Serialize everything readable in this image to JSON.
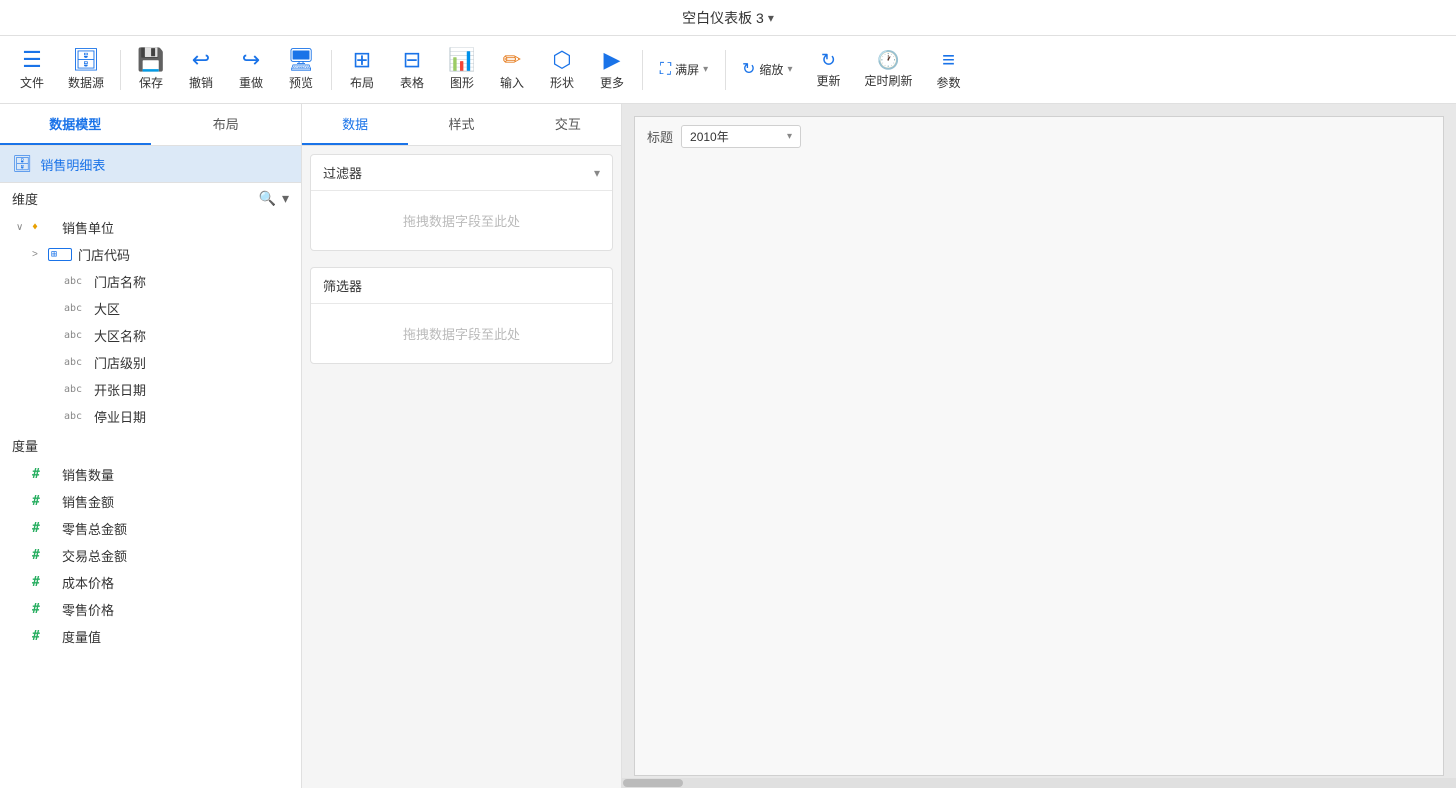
{
  "titleBar": {
    "title": "空白仪表板 3",
    "dropdownArrow": "▾"
  },
  "toolbar": {
    "items": [
      {
        "id": "file",
        "icon": "☰",
        "label": "文件",
        "iconColor": "default"
      },
      {
        "id": "datasource",
        "icon": "🗄",
        "label": "数据源",
        "iconColor": "blue"
      },
      {
        "id": "save",
        "icon": "💾",
        "label": "保存",
        "iconColor": "blue"
      },
      {
        "id": "undo",
        "icon": "↩",
        "label": "撤销",
        "iconColor": "blue"
      },
      {
        "id": "redo",
        "icon": "↪",
        "label": "重做",
        "iconColor": "blue"
      },
      {
        "id": "preview",
        "icon": "🖥",
        "label": "预览",
        "iconColor": "blue"
      },
      {
        "id": "layout",
        "icon": "⊞",
        "label": "布局",
        "iconColor": "blue"
      },
      {
        "id": "table",
        "icon": "⊟",
        "label": "表格",
        "iconColor": "blue"
      },
      {
        "id": "chart",
        "icon": "📊",
        "label": "图形",
        "iconColor": "blue"
      },
      {
        "id": "input",
        "icon": "✏",
        "label": "输入",
        "iconColor": "orange"
      },
      {
        "id": "shape",
        "icon": "⬡",
        "label": "形状",
        "iconColor": "blue"
      },
      {
        "id": "more",
        "icon": "▷",
        "label": "更多",
        "iconColor": "blue"
      },
      {
        "id": "fullscreen",
        "icon": "⛶",
        "label": "满屏",
        "iconColor": "blue",
        "hasArrow": true
      },
      {
        "id": "zoom",
        "icon": "🔍",
        "label": "缩放",
        "iconColor": "blue"
      },
      {
        "id": "update",
        "icon": "↻",
        "label": "更新",
        "iconColor": "blue"
      },
      {
        "id": "timer",
        "icon": "🕐",
        "label": "定时刷新",
        "iconColor": "blue"
      },
      {
        "id": "params",
        "icon": "≡",
        "label": "参数",
        "iconColor": "blue"
      }
    ]
  },
  "leftPanel": {
    "tabs": [
      {
        "id": "datamodel",
        "label": "数据模型",
        "active": true
      },
      {
        "id": "layout",
        "label": "布局",
        "active": false
      }
    ],
    "dataModel": {
      "name": "销售明细表",
      "icon": "db"
    },
    "dimensions": {
      "title": "维度",
      "items": [
        {
          "id": "sales-unit",
          "level": 1,
          "expand": "∨",
          "type": "key",
          "typeLabel": "♦",
          "label": "销售单位"
        },
        {
          "id": "store-code",
          "level": 2,
          "expand": ">",
          "type": "table",
          "typeLabel": "⊞",
          "label": "门店代码"
        },
        {
          "id": "store-name",
          "level": 3,
          "expand": "",
          "type": "abc",
          "typeLabel": "abc",
          "label": "门店名称"
        },
        {
          "id": "district",
          "level": 3,
          "expand": "",
          "type": "abc",
          "typeLabel": "abc",
          "label": "大区"
        },
        {
          "id": "district-name",
          "level": 3,
          "expand": "",
          "type": "abc",
          "typeLabel": "abc",
          "label": "大区名称"
        },
        {
          "id": "store-level",
          "level": 3,
          "expand": "",
          "type": "abc",
          "typeLabel": "abc",
          "label": "门店级别"
        },
        {
          "id": "open-date",
          "level": 3,
          "expand": "",
          "type": "abc",
          "typeLabel": "abc",
          "label": "开张日期"
        },
        {
          "id": "close-date",
          "level": 3,
          "expand": "",
          "type": "abc",
          "typeLabel": "abc",
          "label": "停业日期"
        }
      ]
    },
    "measures": {
      "title": "度量",
      "items": [
        {
          "id": "sales-qty",
          "label": "销售数量"
        },
        {
          "id": "sales-amount",
          "label": "销售金额"
        },
        {
          "id": "retail-total",
          "label": "零售总金额"
        },
        {
          "id": "transaction-total",
          "label": "交易总金额"
        },
        {
          "id": "cost-price",
          "label": "成本价格"
        },
        {
          "id": "retail-price",
          "label": "零售价格"
        },
        {
          "id": "measure-value",
          "label": "度量值"
        }
      ]
    }
  },
  "middlePanel": {
    "tabs": [
      {
        "id": "data",
        "label": "数据",
        "active": true
      },
      {
        "id": "style",
        "label": "样式",
        "active": false
      },
      {
        "id": "interact",
        "label": "交互",
        "active": false
      }
    ],
    "filter": {
      "title": "过滤器",
      "dropZoneText": "拖拽数据字段至此处"
    },
    "selector": {
      "title": "筛选器",
      "dropZoneText": "拖拽数据字段至此处"
    }
  },
  "canvas": {
    "titleLabel": "标题",
    "titleValue": "2010年",
    "dropdownArrow": "▾"
  }
}
